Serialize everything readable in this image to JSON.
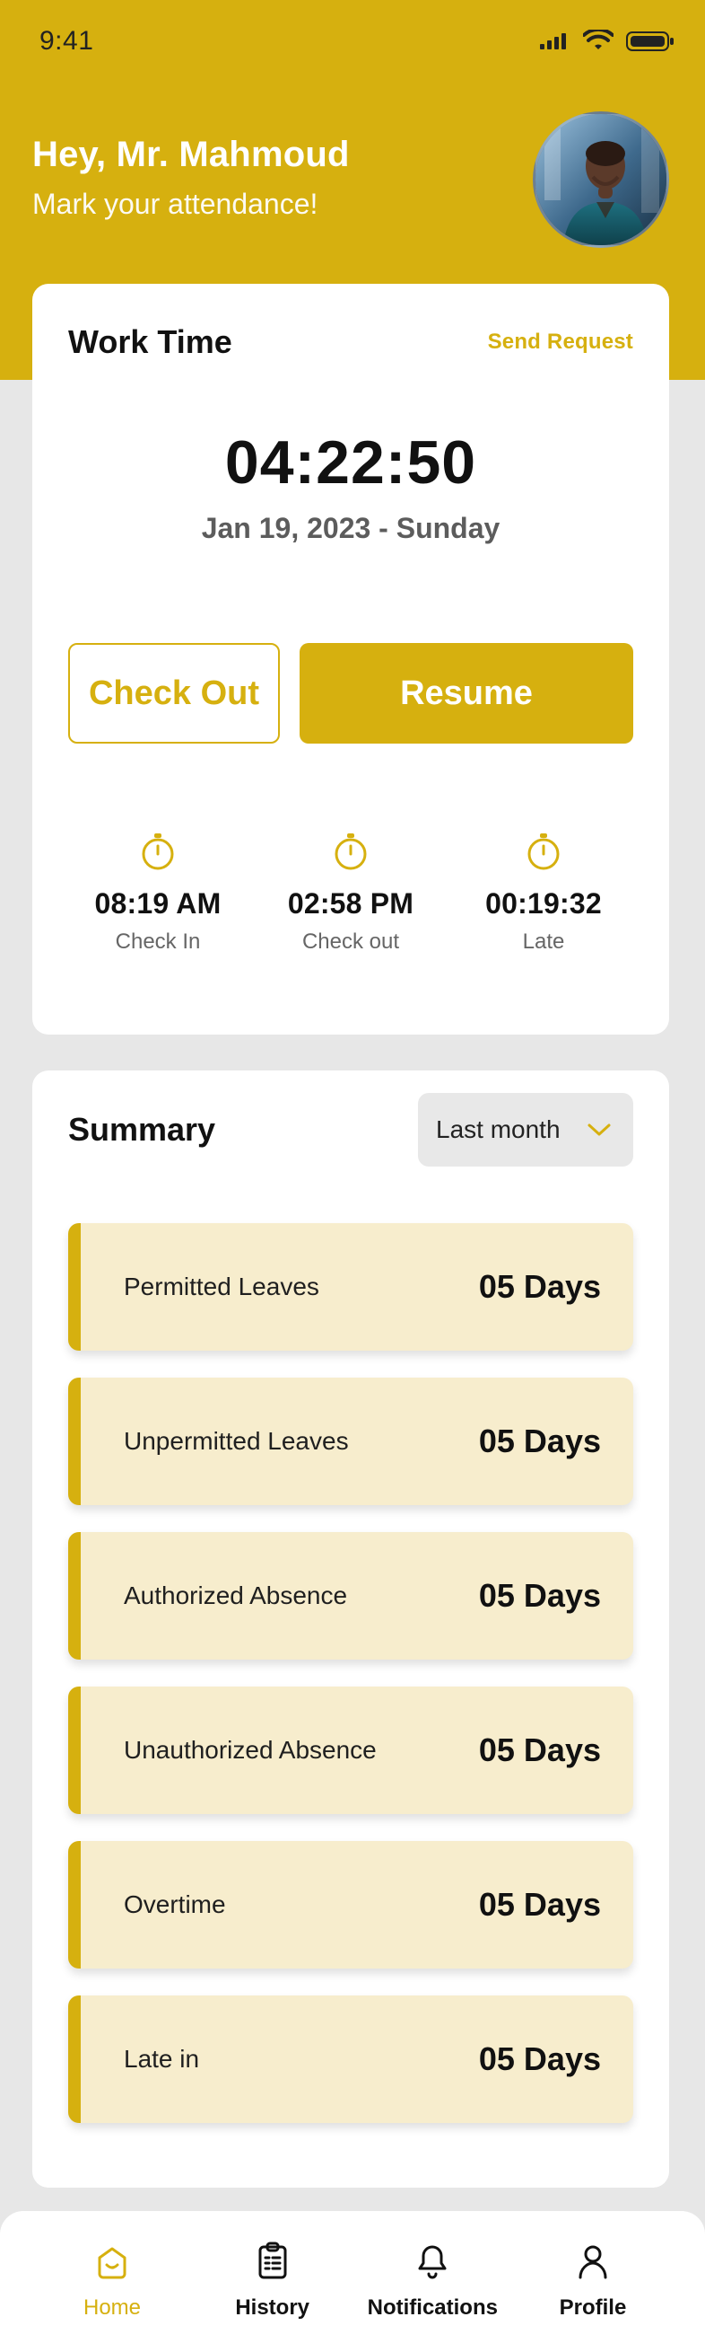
{
  "status": {
    "time": "9:41"
  },
  "header": {
    "greeting": "Hey, Mr. Mahmoud",
    "subtitle": "Mark your attendance!"
  },
  "work_time": {
    "title": "Work Time",
    "send_request": "Send Request",
    "clock": "04:22:50",
    "date": "Jan 19, 2023 - Sunday",
    "buttons": {
      "check_out": "Check Out",
      "resume": "Resume"
    },
    "stats": [
      {
        "value": "08:19 AM",
        "label": "Check In"
      },
      {
        "value": "02:58 PM",
        "label": "Check out"
      },
      {
        "value": "00:19:32",
        "label": "Late"
      }
    ]
  },
  "summary": {
    "title": "Summary",
    "filter": "Last month",
    "items": [
      {
        "label": "Permitted Leaves",
        "value": "05 Days"
      },
      {
        "label": "Unpermitted Leaves",
        "value": "05 Days"
      },
      {
        "label": "Authorized Absence",
        "value": "05 Days"
      },
      {
        "label": "Unauthorized Absence",
        "value": "05 Days"
      },
      {
        "label": "Overtime",
        "value": "05 Days"
      },
      {
        "label": "Late in",
        "value": "05 Days"
      }
    ]
  },
  "nav": {
    "home": "Home",
    "history": "History",
    "notifications": "Notifications",
    "profile": "Profile"
  },
  "colors": {
    "accent": "#D6B00F",
    "cream": "#F7EDCD",
    "background": "#E7E7E7"
  },
  "icons": {
    "signal": "signal-icon",
    "wifi": "wifi-icon",
    "battery": "battery-icon",
    "stopwatch": "stopwatch-icon",
    "chevron": "chevron-down-icon",
    "home": "home-icon",
    "history": "clipboard-icon",
    "notifications": "bell-icon",
    "profile": "user-icon"
  }
}
